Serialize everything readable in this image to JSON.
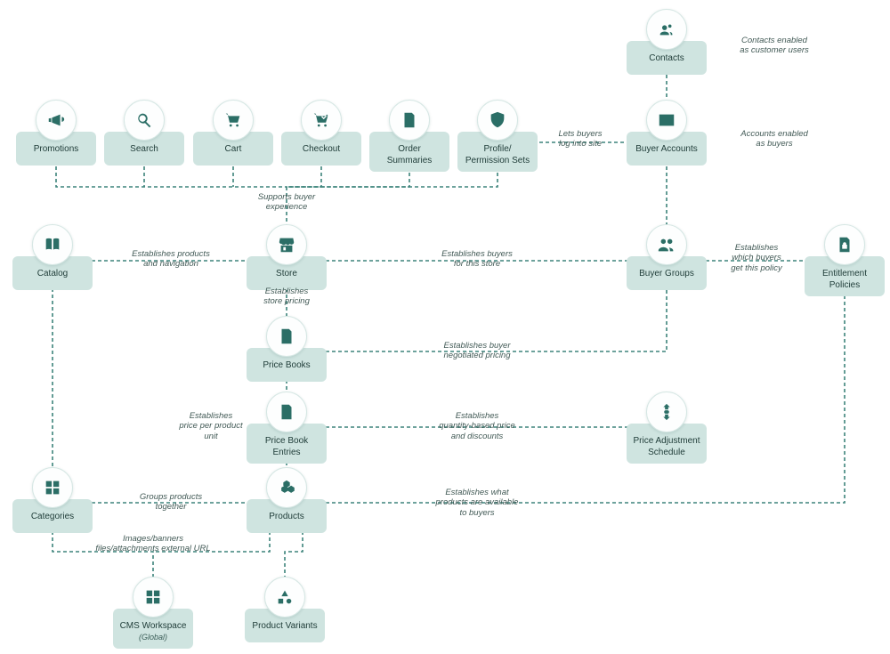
{
  "colors": {
    "nodeFill": "#cfe4e0",
    "iconFill": "#2b6e66",
    "connector": "#3d847b"
  },
  "nodes": {
    "contacts": {
      "label": "Contacts",
      "icon": "contacts-icon"
    },
    "buyerAccts": {
      "label": "Buyer Accounts",
      "icon": "id-card-icon"
    },
    "promotions": {
      "label": "Promotions",
      "icon": "megaphone-icon"
    },
    "search": {
      "label": "Search",
      "icon": "search-icon"
    },
    "cart": {
      "label": "Cart",
      "icon": "cart-icon"
    },
    "checkout": {
      "label": "Checkout",
      "icon": "cart-check-icon"
    },
    "orderSumm": {
      "label": "Order Summaries",
      "icon": "document-icon"
    },
    "profilePerm": {
      "label": "Profile/\nPermission Sets",
      "icon": "shield-user-icon"
    },
    "catalog": {
      "label": "Catalog",
      "icon": "book-icon"
    },
    "store": {
      "label": "Store",
      "icon": "storefront-icon"
    },
    "buyerGroups": {
      "label": "Buyer Groups",
      "icon": "people-icon"
    },
    "entPolicies": {
      "label": "Entitlement Policies",
      "icon": "file-lock-icon"
    },
    "priceBooks": {
      "label": "Price Books",
      "icon": "price-tag-icon"
    },
    "pbEntries": {
      "label": "Price Book Entries",
      "icon": "list-doc-icon"
    },
    "priceAdj": {
      "label": "Price Adjustment Schedule",
      "icon": "price-adjust-icon"
    },
    "categories": {
      "label": "Categories",
      "icon": "categories-icon"
    },
    "products": {
      "label": "Products",
      "icon": "boxes-icon"
    },
    "cmsWs": {
      "label": "CMS Workspace",
      "sub": "(Global)",
      "icon": "grid-icon"
    },
    "prodVar": {
      "label": "Product Variants",
      "icon": "shapes-icon"
    }
  },
  "edges": {
    "contactsEnabled": "Contacts enabled\nas customer users",
    "accountsEnabled": "Accounts enabled\nas buyers",
    "letsBuyers": "Lets buyers\nlog into site",
    "supportsBuyer": "Supports buyer\nexperience",
    "estProdNav": "Establishes products\nand navigation",
    "estBuyersStore": "Establishes buyers\nfor this store",
    "whichBuyers": "Establishes\nwhich buyers\nget this policy",
    "storePricing": "Establishes\nstore pricing",
    "buyerNegPricing": "Establishes buyer\nnegotiated pricing",
    "pricePerUnit": "Establishes\nprice per product\nunit",
    "qtyDiscounts": "Establishes\nquantity-based price\nand discounts",
    "groupsProducts": "Groups products\ntogether",
    "prodAvail": "Establishes what\nproducts are available\nto buyers",
    "imagesBanners": "Images/banners\nfiles/attachments external URL"
  }
}
